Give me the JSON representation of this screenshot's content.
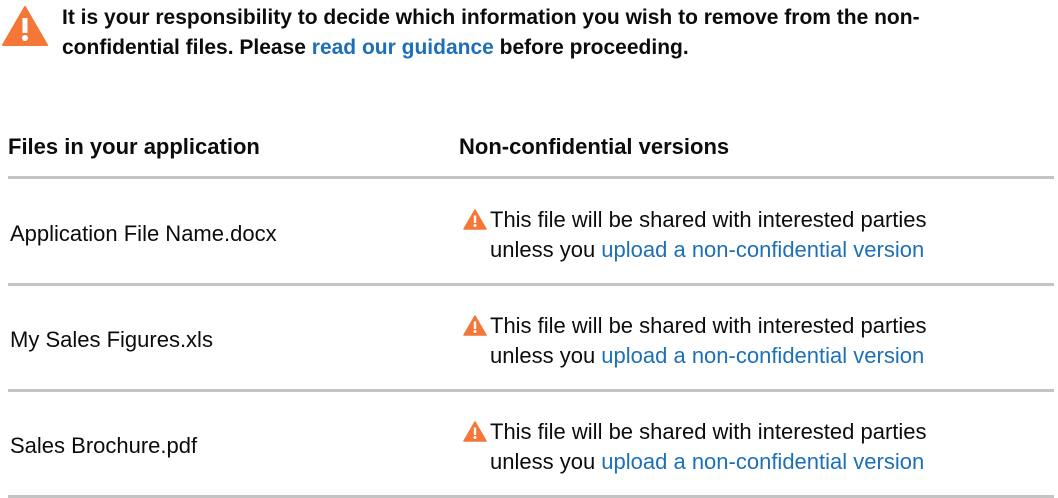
{
  "warning": {
    "icon": "warning-icon",
    "text_before": "It is your responsibility to decide which information you wish to remove from the non-confidential files. Please ",
    "link_text": "read our guidance",
    "text_after": " before proceeding."
  },
  "table": {
    "headers": [
      "Files in your application",
      "Non-confidential versions"
    ],
    "rows": [
      {
        "file_name": "Application File Name.docx",
        "notice_line1": "This file will be shared with interested parties",
        "notice_prefix": "unless you ",
        "notice_link": "upload a non-confidential version"
      },
      {
        "file_name": "My Sales Figures.xls",
        "notice_line1": "This file will be shared with interested parties",
        "notice_prefix": "unless you ",
        "notice_link": "upload a non-confidential version"
      },
      {
        "file_name": "Sales Brochure.pdf",
        "notice_line1": "This file will be shared with interested parties",
        "notice_prefix": "unless you ",
        "notice_link": "upload a non-confidential version"
      }
    ]
  },
  "colors": {
    "warning_orange": "#f47738",
    "link_blue": "#1d70b8",
    "divider_grey": "#c4c4c4",
    "text": "#0b0c0c"
  }
}
